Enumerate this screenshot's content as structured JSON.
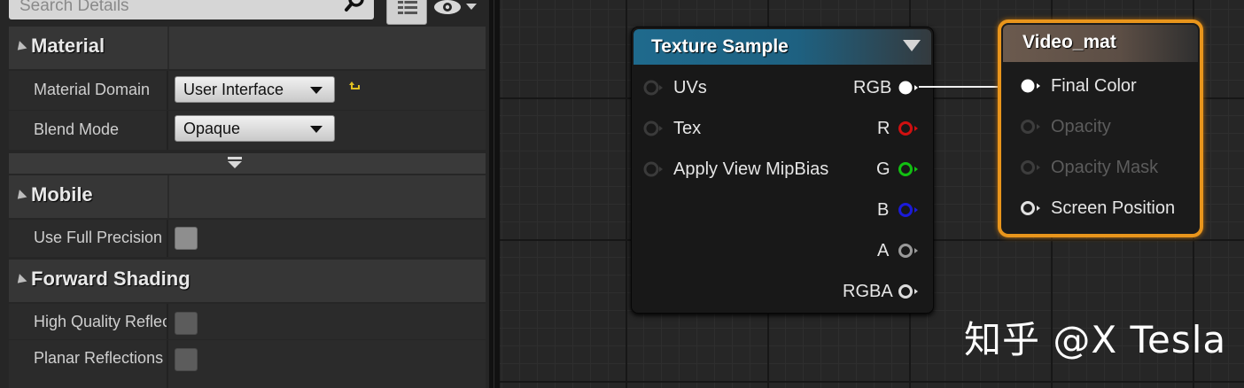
{
  "details": {
    "search": {
      "placeholder": "Search Details"
    },
    "categories": {
      "material": "Material",
      "mobile": "Mobile",
      "forward_shading": "Forward Shading"
    },
    "properties": {
      "material_domain": {
        "label": "Material Domain",
        "value": "User Interface"
      },
      "blend_mode": {
        "label": "Blend Mode",
        "value": "Opaque"
      },
      "use_full_precision": {
        "label": "Use Full Precision"
      },
      "high_quality_reflections": {
        "label": "High Quality Reflections"
      },
      "planar_reflections": {
        "label": "Planar Reflections"
      }
    }
  },
  "graph": {
    "texture_sample": {
      "title": "Texture Sample",
      "inputs": [
        "UVs",
        "Tex",
        "Apply View MipBias"
      ],
      "outputs": [
        "RGB",
        "R",
        "G",
        "B",
        "A",
        "RGBA"
      ]
    },
    "video_mat": {
      "title": "Video_mat",
      "inputs": [
        "Final Color",
        "Opacity",
        "Opacity Mask",
        "Screen Position"
      ]
    },
    "pin_colors": {
      "rgb": "#ffffff",
      "r": "#d01010",
      "g": "#12c012",
      "b": "#1b1bd8",
      "a": "#9a9a9a",
      "rgba": "#dcdcdc"
    },
    "node_border_color": "#e8951c"
  },
  "watermark": "知乎 @X Tesla"
}
